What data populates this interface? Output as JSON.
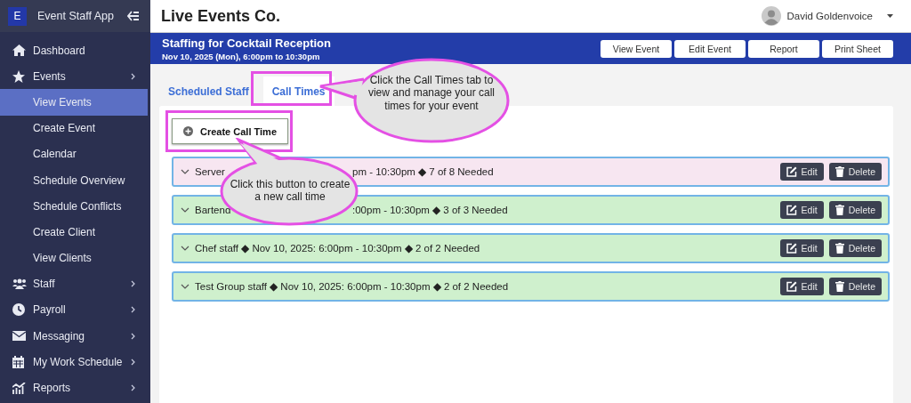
{
  "sidebar": {
    "app_initial": "E",
    "app_name": "Event Staff App",
    "items": [
      {
        "label": "Dashboard",
        "kind": "section",
        "expandable": false,
        "selected": false
      },
      {
        "label": "Events",
        "kind": "section",
        "expandable": true,
        "selected": false
      },
      {
        "label": "View Events",
        "kind": "subitem",
        "selected": true
      },
      {
        "label": "Create Event",
        "kind": "subitem",
        "selected": false
      },
      {
        "label": "Calendar",
        "kind": "subitem",
        "selected": false
      },
      {
        "label": "Schedule Overview",
        "kind": "subitem",
        "selected": false
      },
      {
        "label": "Schedule Conflicts",
        "kind": "subitem",
        "selected": false
      },
      {
        "label": "Create Client",
        "kind": "subitem",
        "selected": false
      },
      {
        "label": "View Clients",
        "kind": "subitem",
        "selected": false
      },
      {
        "label": "Staff",
        "kind": "section",
        "expandable": true,
        "selected": false
      },
      {
        "label": "Payroll",
        "kind": "section",
        "expandable": true,
        "selected": false
      },
      {
        "label": "Messaging",
        "kind": "section",
        "expandable": true,
        "selected": false
      },
      {
        "label": "My Work Schedule",
        "kind": "section",
        "expandable": true,
        "selected": false
      },
      {
        "label": "Reports",
        "kind": "section",
        "expandable": true,
        "selected": false
      }
    ]
  },
  "header": {
    "company": "Live Events Co.",
    "user": "David Goldenvoice"
  },
  "banner": {
    "title": "Staffing for Cocktail Reception",
    "subtitle": "Nov 10, 2025 (Mon), 6:00pm to 10:30pm",
    "buttons": [
      "View Event",
      "Edit Event",
      "Report",
      "Print Sheet"
    ]
  },
  "tabs": [
    {
      "label": "Scheduled Staff",
      "selected": false
    },
    {
      "label": "Call Times",
      "selected": true
    }
  ],
  "create_button": "Create Call Time",
  "call_times": [
    {
      "segments": [
        "Server",
        "pm - 10:30pm ◆ 7 of 8 Needed"
      ],
      "color": "#f7e6f1",
      "actions": [
        "Edit",
        "Delete"
      ]
    },
    {
      "segments": [
        "Bartend",
        ":00pm - 10:30pm ◆ 3 of 3 Needed"
      ],
      "color": "#cff0cd",
      "actions": [
        "Edit",
        "Delete"
      ]
    },
    {
      "segments": [
        "Chef staff ◆ Nov 10, 2025: 6:00pm - 10:30pm ◆ 2 of 2 Needed"
      ],
      "color": "#cff0cd",
      "actions": [
        "Edit",
        "Delete"
      ]
    },
    {
      "segments": [
        "Test Group staff ◆ Nov 10, 2025: 6:00pm - 10:30pm ◆ 2 of 2 Needed"
      ],
      "color": "#cff0cd",
      "actions": [
        "Edit",
        "Delete"
      ]
    }
  ],
  "callouts": [
    "Click the Call Times tab to view and manage your call times for your event",
    "Click this button to create a new call time"
  ]
}
